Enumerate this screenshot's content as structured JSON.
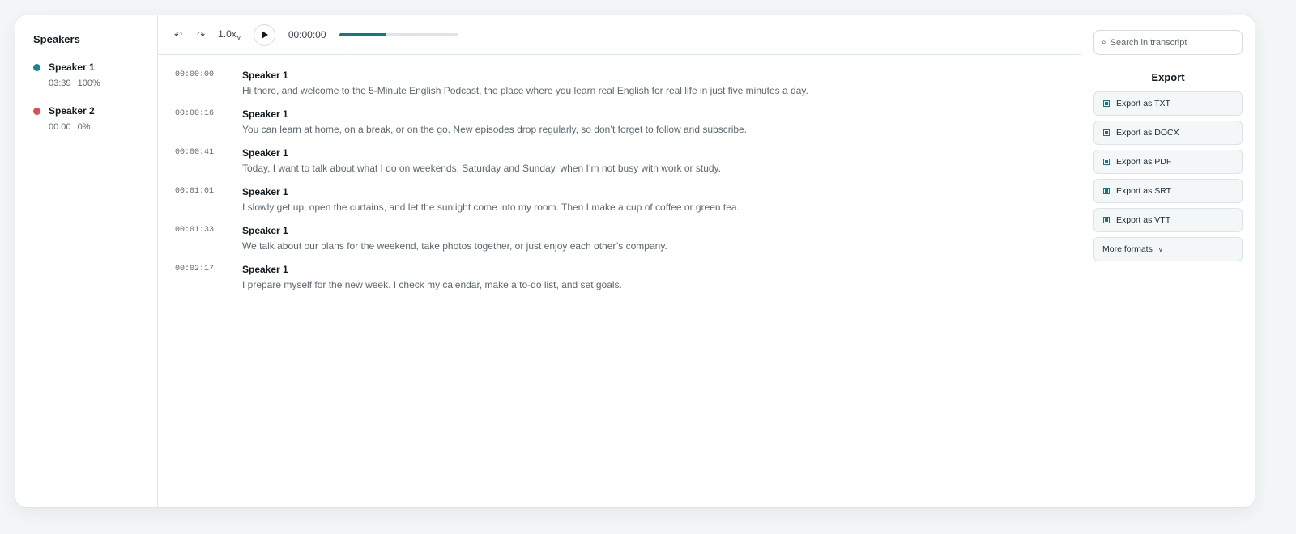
{
  "speakers": {
    "title": "Speakers",
    "items": [
      {
        "name": "Speaker 1",
        "duration": "03:39",
        "percent": "100%",
        "color": "#158a91"
      },
      {
        "name": "Speaker 2",
        "duration": "00:00",
        "percent": "0%",
        "color": "#e14b5a"
      }
    ]
  },
  "player": {
    "undo_icon": "↶",
    "redo_icon": "↷",
    "speed": "1.0x",
    "speed_caret": "v",
    "current_time": "00:00:00",
    "progress": 0.4,
    "progress_color": "#117a80"
  },
  "transcript": {
    "segments": [
      {
        "timestamp": "00:00:00",
        "speaker": "Speaker 1",
        "text": "Hi there, and welcome to the 5-Minute English Podcast, the place where you learn real English for real life in just five minutes a day."
      },
      {
        "timestamp": "00:00:16",
        "speaker": "Speaker 1",
        "text": "You can learn at home, on a break, or on the go. New episodes drop regularly, so don’t forget to follow and subscribe."
      },
      {
        "timestamp": "00:00:41",
        "speaker": "Speaker 1",
        "text": "Today, I want to talk about what I do on weekends, Saturday and Sunday, when I’m not busy with work or study."
      },
      {
        "timestamp": "00:01:01",
        "speaker": "Speaker 1",
        "text": "I slowly get up, open the curtains, and let the sunlight come into my room. Then I make a cup of coffee or green tea."
      },
      {
        "timestamp": "00:01:33",
        "speaker": "Speaker 1",
        "text": "We talk about our plans for the weekend, take photos together, or just enjoy each other’s company."
      },
      {
        "timestamp": "00:02:17",
        "speaker": "Speaker 1",
        "text": "I prepare myself for the new week. I check my calendar, make a to-do list, and set goals."
      }
    ]
  },
  "side": {
    "search_placeholder": "Search in transcript",
    "search_icon": "⌕",
    "export_title": "Export",
    "export_buttons": [
      {
        "label": "Export as TXT"
      },
      {
        "label": "Export as DOCX"
      },
      {
        "label": "Export as PDF"
      },
      {
        "label": "Export as SRT"
      },
      {
        "label": "Export as VTT"
      }
    ],
    "more_label": "More formats",
    "more_caret": "v"
  }
}
